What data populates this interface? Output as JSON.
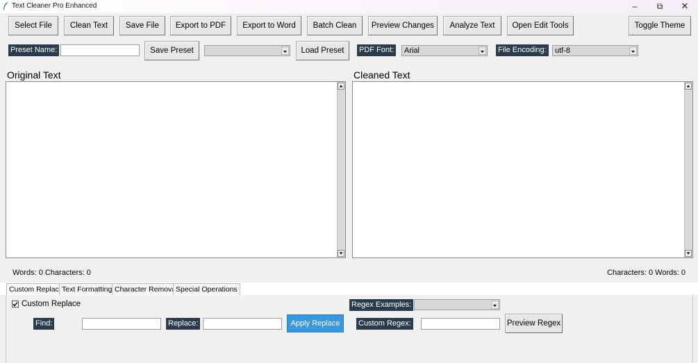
{
  "window": {
    "title": "Text Cleaner Pro Enhanced"
  },
  "toolbar": {
    "select_file": "Select File",
    "clean_text": "Clean Text",
    "save_file": "Save File",
    "export_pdf": "Export to PDF",
    "export_word": "Export to Word",
    "batch_clean": "Batch Clean",
    "preview_changes": "Preview Changes",
    "analyze_text": "Analyze Text",
    "open_edit_tools": "Open Edit Tools",
    "toggle_theme": "Toggle Theme"
  },
  "preset_bar": {
    "preset_name_label": "Preset Name:",
    "preset_name_value": "",
    "save_preset": "Save Preset",
    "preset_select_value": "",
    "load_preset": "Load Preset",
    "pdf_font_label": "PDF Font:",
    "pdf_font_value": "Arial",
    "encoding_label": "File Encoding:",
    "encoding_value": "utf-8"
  },
  "original": {
    "title": "Original Text",
    "stats": "Words: 0  Characters: 0"
  },
  "cleaned": {
    "title": "Cleaned Text",
    "stats": "Characters: 0  Words: 0"
  },
  "tabs": [
    "Custom Replace",
    "Text Formatting",
    "Character Removal",
    "Special Operations"
  ],
  "custom_replace": {
    "checkbox_label": "Custom Replace",
    "checked": true,
    "regex_examples_label": "Regex Examples:",
    "regex_examples_value": "",
    "find_label": "Find:",
    "find_value": "",
    "replace_label": "Replace:",
    "replace_value": "",
    "apply_replace": "Apply Replace",
    "custom_regex_label": "Custom Regex:",
    "custom_regex_value": "",
    "preview_regex": "Preview Regex"
  },
  "colors": {
    "dark_label": "#2b3b4b",
    "accent_button": "#3a96dd"
  },
  "icons": [
    "feather-app-icon",
    "minimize-icon",
    "restore-icon",
    "close-icon",
    "dropdown-arrow-icon",
    "scroll-up-icon",
    "scroll-down-icon",
    "checkbox-check-icon"
  ]
}
